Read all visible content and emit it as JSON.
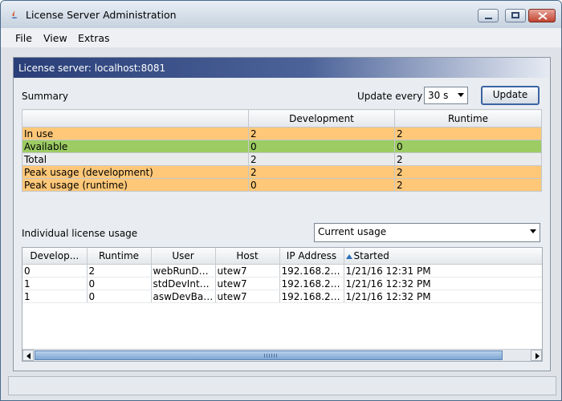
{
  "window": {
    "title": "License Server Administration",
    "icons": {
      "app": "java-app-icon",
      "minimize": "minimize-icon",
      "maximize": "maximize-icon",
      "close": "close-icon"
    }
  },
  "menu": [
    {
      "label": "File",
      "mnemonic": "F"
    },
    {
      "label": "View",
      "mnemonic": "V"
    },
    {
      "label": "Extras",
      "mnemonic": "E"
    }
  ],
  "server": {
    "title": "License server: localhost:8081"
  },
  "summary": {
    "label": "Summary",
    "update_label": "Update every",
    "update_interval": "30 s",
    "update_button": "Update",
    "columns": [
      "",
      "Development",
      "Runtime"
    ],
    "rows": [
      {
        "name": "In use",
        "development": "2",
        "runtime": "2",
        "color": "#ffc878"
      },
      {
        "name": "Available",
        "development": "0",
        "runtime": "0",
        "color": "#9ccc63"
      },
      {
        "name": "Total",
        "development": "2",
        "runtime": "2",
        "color": "#e9eaec"
      },
      {
        "name": "Peak usage (development)",
        "development": "2",
        "runtime": "2",
        "color": "#ffc878"
      },
      {
        "name": "Peak usage (runtime)",
        "development": "0",
        "runtime": "2",
        "color": "#ffc878"
      }
    ]
  },
  "individual": {
    "label": "Individual license usage",
    "view_selected": "Current usage",
    "columns": [
      "Develop...",
      "Runtime",
      "User",
      "Host",
      "IP Address",
      "Started"
    ],
    "rows": [
      [
        "0",
        "2",
        "webRunDa...",
        "utew7",
        "192.168.22....",
        "1/21/16 12:31 PM"
      ],
      [
        "1",
        "0",
        "stdDevInter...",
        "utew7",
        "192.168.22....",
        "1/21/16 12:32 PM"
      ],
      [
        "1",
        "0",
        "aswDevBatch",
        "utew7",
        "192.168.22....",
        "1/21/16 12:32 PM"
      ]
    ],
    "sort_column": "Started"
  }
}
